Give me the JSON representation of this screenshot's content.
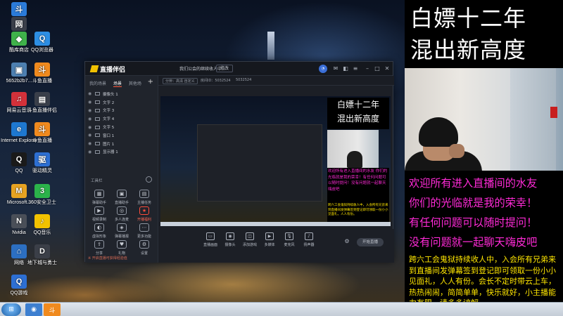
{
  "desktop": {
    "icons": [
      {
        "label": "斗鱼",
        "color": "#2b7bd9",
        "glyph": "斗"
      },
      {
        "label": "网易号",
        "color": "#3a3f4a",
        "glyph": "网"
      },
      {
        "label": "酷库商店",
        "color": "#3fb24a",
        "glyph": "◆"
      },
      {
        "label": "QQ浏览器",
        "color": "#2d8ee3",
        "glyph": "Q"
      },
      {
        "label": "5652b2b7...",
        "color": "#4d7fb0",
        "glyph": "▣"
      },
      {
        "label": "斗鱼直播",
        "color": "#f08a1e",
        "glyph": "斗"
      },
      {
        "label": "网易云音乐",
        "color": "#d3313a",
        "glyph": "♫"
      },
      {
        "label": "斗鱼直播伴侣",
        "color": "#3a3f4a",
        "glyph": "▤"
      },
      {
        "label": "Internet Explorer",
        "color": "#1e78d0",
        "glyph": "e"
      },
      {
        "label": "斗鱼直播",
        "color": "#f08a1e",
        "glyph": "斗"
      },
      {
        "label": "QQ",
        "color": "#1a1a1a",
        "glyph": "Q"
      },
      {
        "label": "驱动精灵",
        "color": "#2d6fd3",
        "glyph": "驱"
      },
      {
        "label": "Microsoft...",
        "color": "#e7a321",
        "glyph": "M"
      },
      {
        "label": "360安全卫士",
        "color": "#2bb34a",
        "glyph": "3"
      },
      {
        "label": "Nvidia",
        "color": "#4a4f58",
        "glyph": "N"
      },
      {
        "label": "QQ音乐",
        "color": "#f2c200",
        "glyph": "♪"
      },
      {
        "label": "网络",
        "color": "#2c6fc2",
        "glyph": "⌂"
      },
      {
        "label": "地下城与勇士",
        "color": "#3b3f48",
        "glyph": "D"
      },
      {
        "label": "QQ游戏",
        "color": "#2d6fd3",
        "glyph": "Q"
      }
    ]
  },
  "taskbar": {
    "start_glyph": "⊞",
    "apps": [
      {
        "name": "taskbar-explorer",
        "color": "#3d7fd0",
        "glyph": "◉"
      },
      {
        "name": "taskbar-douyu",
        "color": "#f08a1e",
        "glyph": "斗"
      }
    ]
  },
  "app": {
    "logo": "直播伴侣",
    "stream_title": "我们公会的继续收人中...",
    "edit_label": "修改",
    "sub_items": [
      "分辨：高清 自定义",
      "房间ID：5032524",
      "5032524"
    ],
    "left_tabs": [
      "我的场景",
      "场景",
      "其他场"
    ],
    "sources": [
      "摄像头 1",
      "文字 2",
      "文字 3",
      "文字 4",
      "文字 5",
      "窗口 1",
      "图片 1",
      "显示器 1"
    ],
    "tools_heading": "工具栏",
    "tools": [
      {
        "label": "弹幕助手",
        "glyph": "▦",
        "red": false
      },
      {
        "label": "直播助手",
        "glyph": "▣",
        "red": false
      },
      {
        "label": "主播任务",
        "glyph": "▤",
        "red": false
      },
      {
        "label": "视频录制",
        "glyph": "▶",
        "red": false
      },
      {
        "label": "多人连麦",
        "glyph": "◎",
        "red": false
      },
      {
        "label": "开播福利",
        "glyph": "★",
        "red": true
      },
      {
        "label": "虚拟形象",
        "glyph": "◐",
        "red": false
      },
      {
        "label": "弹幕播报",
        "glyph": "◈",
        "red": false
      },
      {
        "label": "更多功能",
        "glyph": "⋯",
        "red": false
      },
      {
        "label": "分享",
        "glyph": "⇪",
        "red": false
      },
      {
        "label": "礼物",
        "glyph": "♥",
        "red": false
      },
      {
        "label": "设置",
        "glyph": "⚙",
        "red": false
      }
    ],
    "left_footer": "※ 开启直播可获得经验值",
    "bottom_tools": [
      "直播画面",
      "摄像头",
      "添加游戏",
      "多媒体",
      "麦克风",
      "扬声器"
    ],
    "start_live": "开始直播"
  },
  "preview": {
    "title_lines": [
      "白嫖十二年",
      "混出新高度"
    ],
    "welcome": "欢迎所有进入直播间的水友 你们的光临就是我的荣幸！有任何问题可以随时提问！没有问题就一起聊天嗨皮吧",
    "notice": "跨六工会鬼狱持续收人中，入会所有兄弟来到直播间发弹幕签到登记即可领取一份小小见面礼，人人有份。"
  },
  "overlay": {
    "title_line1": "白嫖十二年",
    "title_line2": "混出新高度",
    "welcome_lines": [
      "欢迎所有进入直播间的水友",
      "你们的光临就是我的荣幸！",
      "有任何问题可以随时提问！",
      "没有问题就一起聊天嗨皮吧"
    ],
    "notice": "跨六工会鬼狱持续收人中，入会所有兄弟来到直播间发弹幕签到登记即可领取一份小小见面礼，人人有份。会长不定时带云上车，热热闹闹，简简单单，快乐就好，小主播能力有限，请多多谅解。"
  },
  "colors": {
    "accent": "#ff5a3c",
    "pink": "#ff2ad7",
    "yellow": "#ffe600"
  }
}
